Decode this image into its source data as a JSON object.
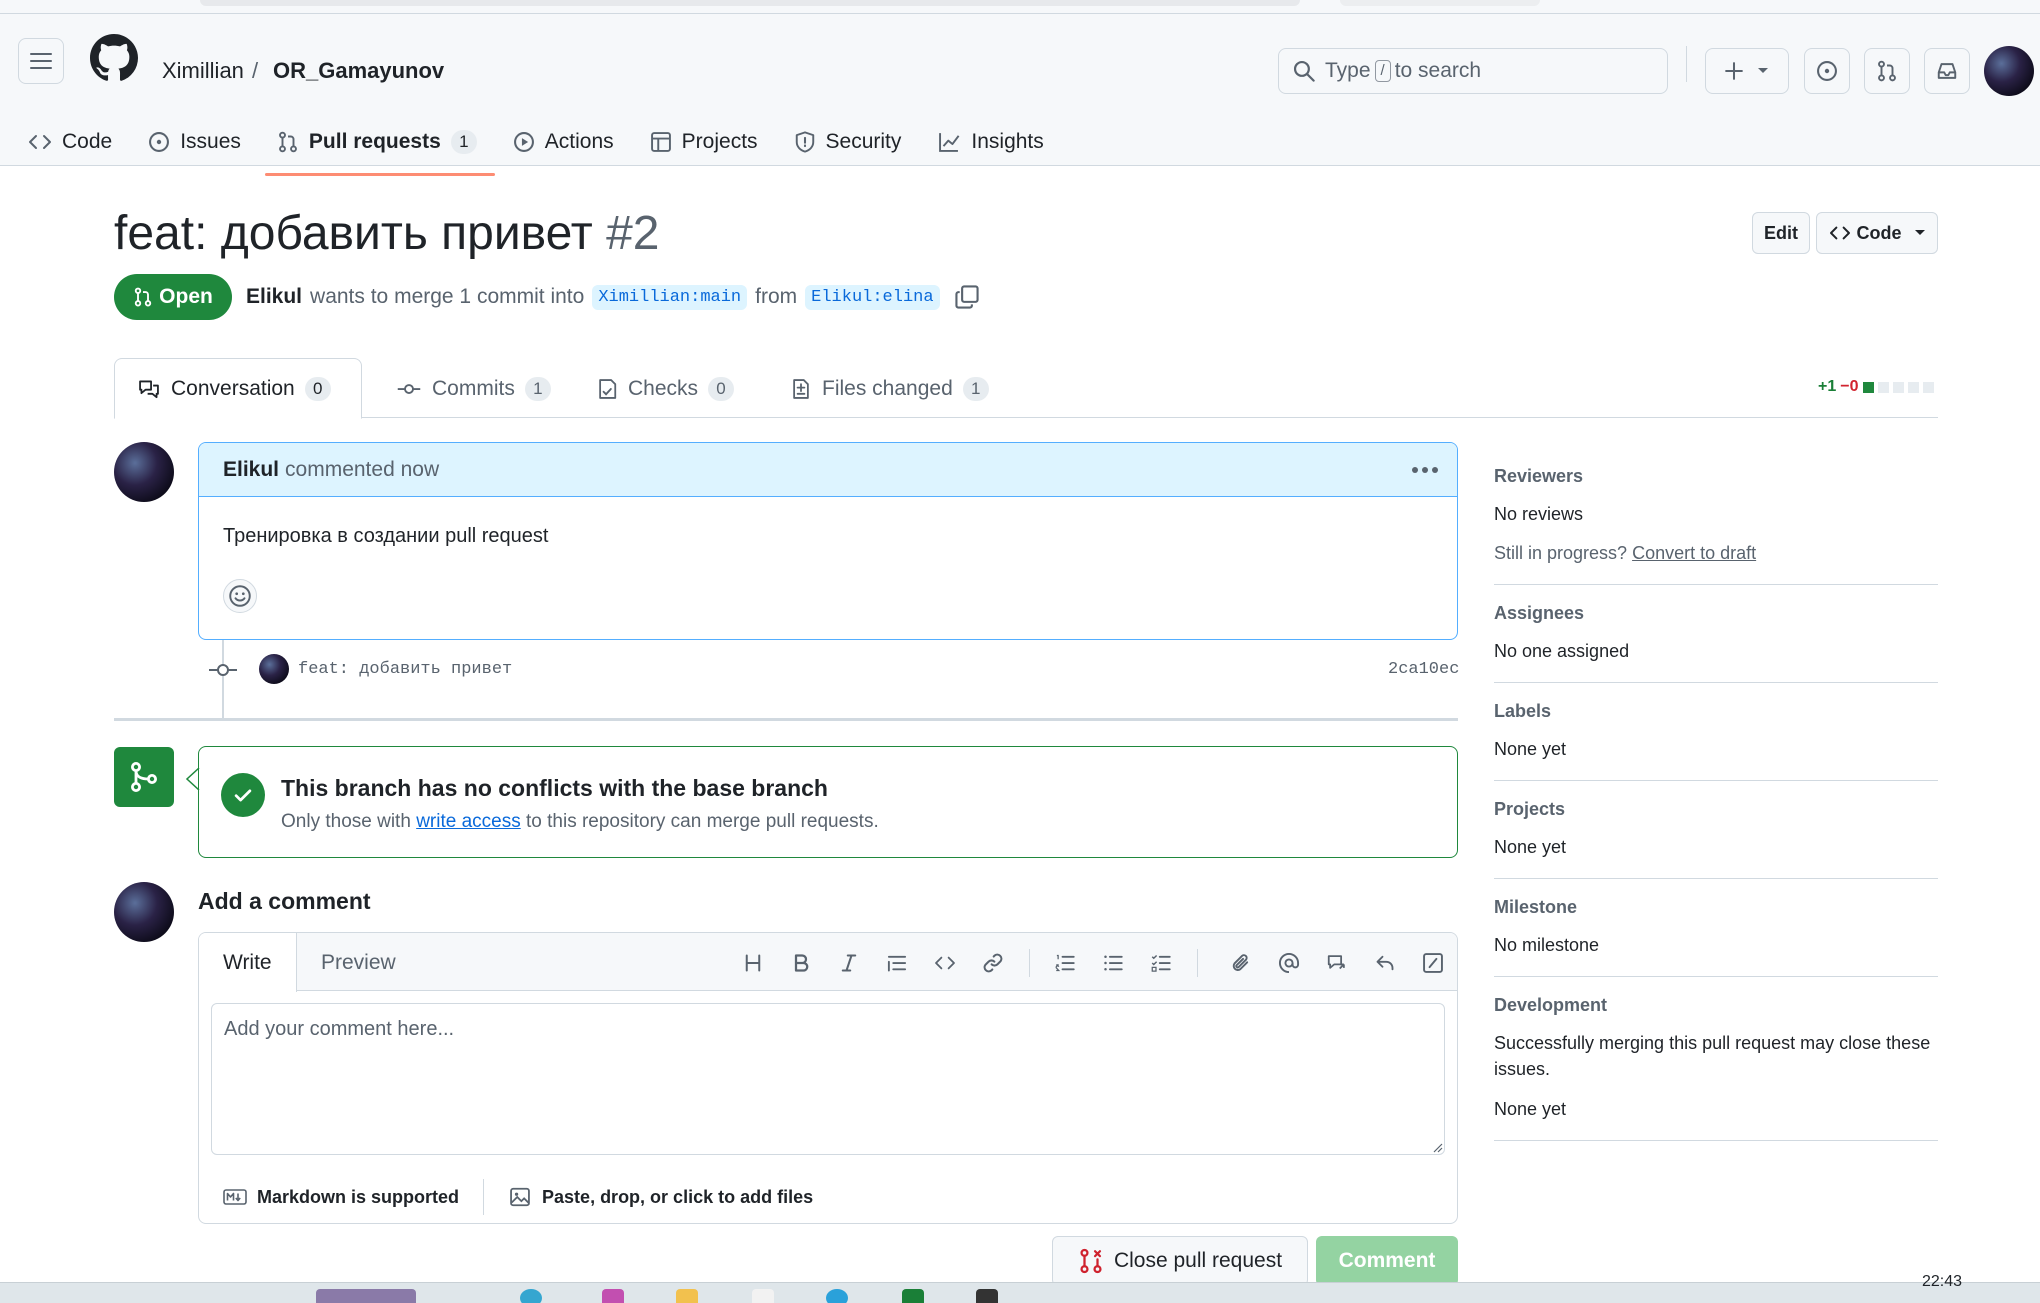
{
  "header": {
    "owner": "Ximillian",
    "separator": "/",
    "repo": "OR_Gamayunov",
    "search_prefix": "Type",
    "search_key": "/",
    "search_suffix": "to search"
  },
  "repo_tabs": [
    {
      "label": "Code"
    },
    {
      "label": "Issues"
    },
    {
      "label": "Pull requests",
      "count": "1"
    },
    {
      "label": "Actions"
    },
    {
      "label": "Projects"
    },
    {
      "label": "Security"
    },
    {
      "label": "Insights"
    }
  ],
  "pr": {
    "title": "feat: добавить привет",
    "number": "#2",
    "edit_label": "Edit",
    "code_label": "Code",
    "state": "Open",
    "author": "Elikul",
    "meta_text": "wants to merge 1 commit into",
    "base": "Ximillian:main",
    "from_text": "from",
    "head": "Elikul:elina"
  },
  "pr_tabs": [
    {
      "label": "Conversation",
      "count": "0"
    },
    {
      "label": "Commits",
      "count": "1"
    },
    {
      "label": "Checks",
      "count": "0"
    },
    {
      "label": "Files changed",
      "count": "1"
    }
  ],
  "diffstat": {
    "additions": "+1",
    "deletions": "−0"
  },
  "comment": {
    "author": "Elikul",
    "when": "commented now",
    "body": "Тренировка в создании pull request"
  },
  "commit": {
    "message": "feat: добавить привет",
    "sha": "2ca10ec"
  },
  "merge": {
    "title": "This branch has no conflicts with the base branch",
    "sub_prefix": "Only those with",
    "sub_link": "write access",
    "sub_suffix": "to this repository can merge pull requests."
  },
  "add_comment": {
    "title": "Add a comment",
    "tab_write": "Write",
    "tab_preview": "Preview",
    "placeholder": "Add your comment here...",
    "markdown_note": "Markdown is supported",
    "attach_note": "Paste, drop, or click to add files",
    "close_label": "Close pull request",
    "comment_label": "Comment"
  },
  "sidebar": {
    "reviewers": {
      "heading": "Reviewers",
      "value": "No reviews",
      "progress_prefix": "Still in progress?",
      "progress_link": "Convert to draft"
    },
    "assignees": {
      "heading": "Assignees",
      "value": "No one assigned"
    },
    "labels": {
      "heading": "Labels",
      "value": "None yet"
    },
    "projects": {
      "heading": "Projects",
      "value": "None yet"
    },
    "milestone": {
      "heading": "Milestone",
      "value": "No milestone"
    },
    "development": {
      "heading": "Development",
      "text": "Successfully merging this pull request may close these issues.",
      "value": "None yet"
    }
  },
  "taskbar": {
    "time": "22:43"
  },
  "colors": {
    "accent": "#0969da",
    "open_green": "#1f883d",
    "active_tab_underline": "#fd8c73"
  }
}
